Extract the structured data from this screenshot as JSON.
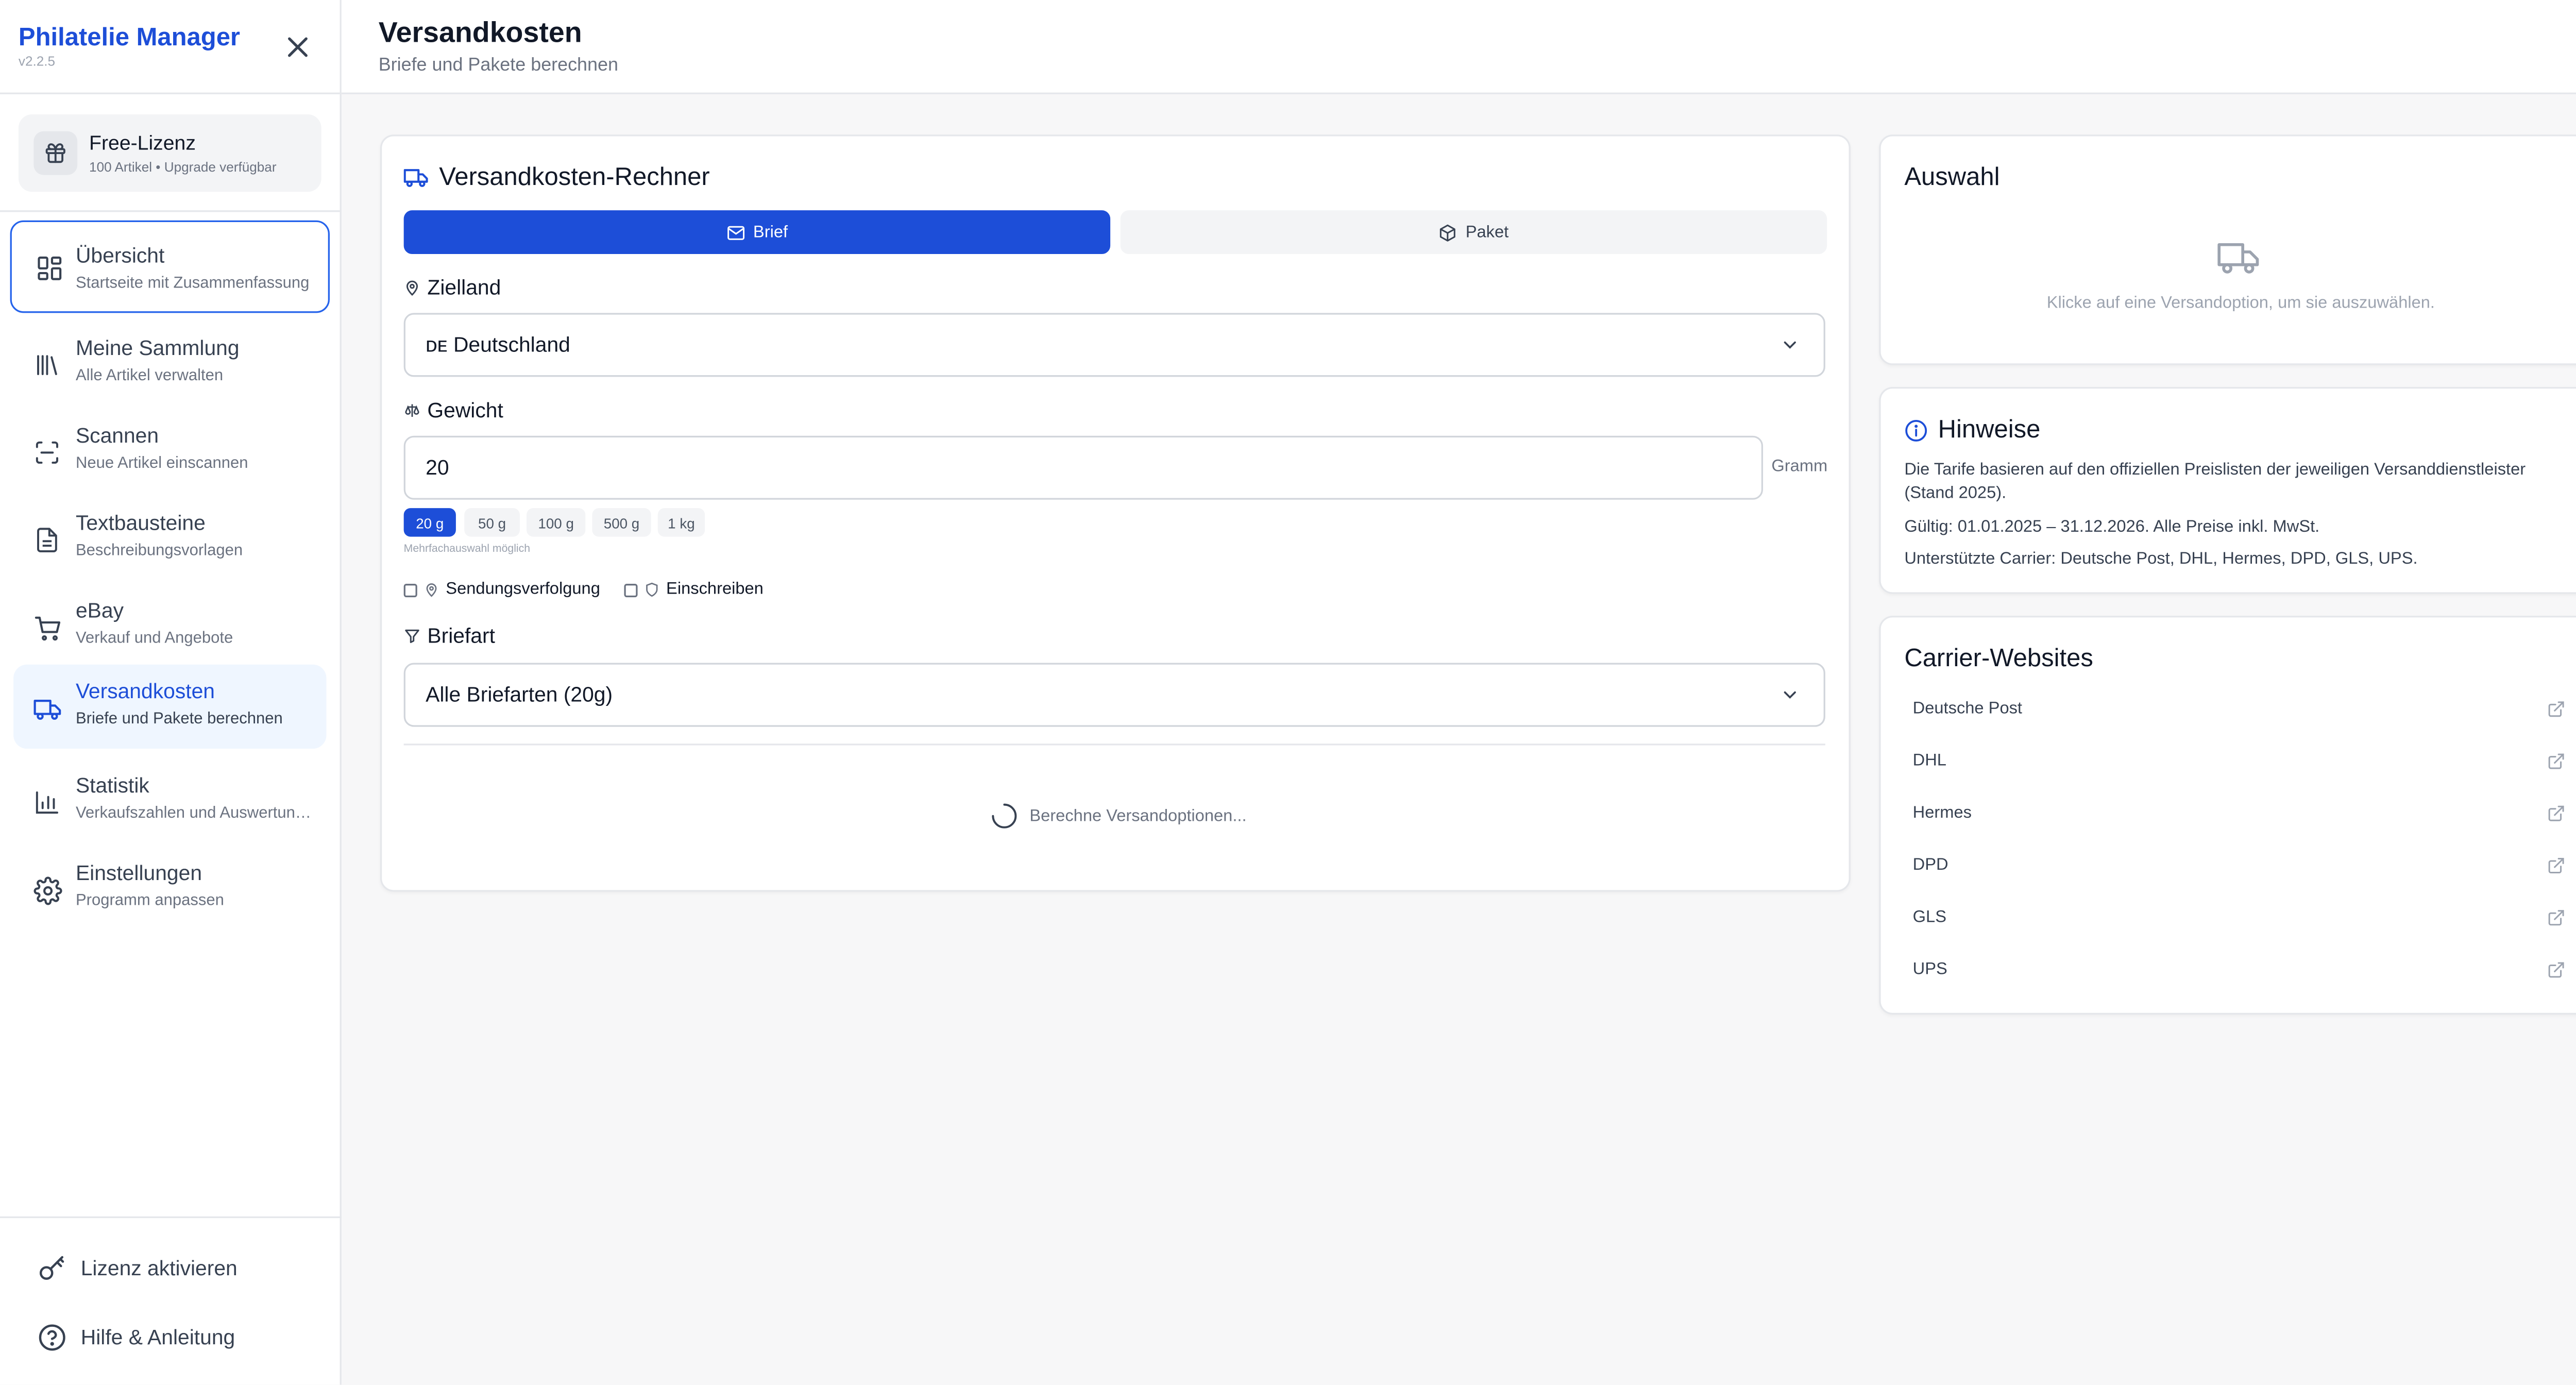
{
  "app": {
    "title": "Philatelie Manager",
    "version": "v2.2.5"
  },
  "license": {
    "title": "Free-Lizenz",
    "subtitle": "100 Artikel • Upgrade verfügbar"
  },
  "nav": [
    {
      "label": "Übersicht",
      "sub": "Startseite mit Zusammenfassung",
      "icon": "dashboard-icon"
    },
    {
      "label": "Meine Sammlung",
      "sub": "Alle Artikel verwalten",
      "icon": "library-icon"
    },
    {
      "label": "Scannen",
      "sub": "Neue Artikel einscannen",
      "icon": "scan-icon"
    },
    {
      "label": "Textbausteine",
      "sub": "Beschreibungsvorlagen",
      "icon": "document-icon"
    },
    {
      "label": "eBay",
      "sub": "Verkauf und Angebote",
      "icon": "cart-icon"
    },
    {
      "label": "Versandkosten",
      "sub": "Briefe und Pakete berechnen",
      "icon": "truck-icon"
    },
    {
      "label": "Statistik",
      "sub": "Verkaufszahlen und Auswertungen",
      "icon": "bar-chart-icon"
    },
    {
      "label": "Einstellungen",
      "sub": "Programm anpassen",
      "icon": "gear-icon"
    }
  ],
  "footer": {
    "activate": "Lizenz aktivieren",
    "help": "Hilfe & Anleitung"
  },
  "header": {
    "title": "Versandkosten",
    "subtitle": "Briefe und Pakete berechnen"
  },
  "calculator": {
    "title": "Versandkosten-Rechner",
    "tabs": {
      "brief": "Brief",
      "paket": "Paket"
    },
    "destination_label": "Zielland",
    "destination_value": "ᴅᴇ Deutschland",
    "weight_label": "Gewicht",
    "weight_value": "20",
    "weight_unit": "Gramm",
    "weight_presets": [
      "20 g",
      "50 g",
      "100 g",
      "500 g",
      "1 kg"
    ],
    "multi_hint": "Mehrfachauswahl möglich",
    "tracking_label": "Sendungsverfolgung",
    "registered_label": "Einschreiben",
    "letter_type_label": "Briefart",
    "letter_type_value": "Alle Briefarten (20g)",
    "loading_text": "Berechne Versandoptionen..."
  },
  "selection": {
    "title": "Auswahl",
    "empty_text": "Klicke auf eine Versandoption, um sie auszuwählen."
  },
  "notes": {
    "title": "Hinweise",
    "lines": [
      "Die Tarife basieren auf den offiziellen Preislisten der jeweiligen Versanddienstleister (Stand 2025).",
      "Gültig: 01.01.2025 – 31.12.2026. Alle Preise inkl. MwSt.",
      "Unterstützte Carrier: Deutsche Post, DHL, Hermes, DPD, GLS, UPS."
    ]
  },
  "carriers": {
    "title": "Carrier-Websites",
    "items": [
      "Deutsche Post",
      "DHL",
      "Hermes",
      "DPD",
      "GLS",
      "UPS"
    ]
  },
  "colors": {
    "accent": "#1d4ed8",
    "active_bg": "#eff6ff"
  }
}
